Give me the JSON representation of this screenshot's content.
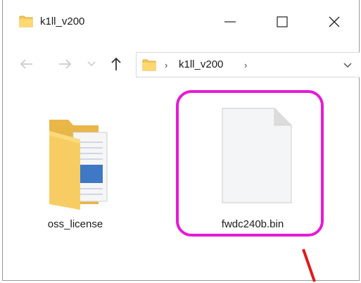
{
  "window": {
    "title": "k1ll_v200"
  },
  "address_bar": {
    "crumbs": [
      "k1ll_v200"
    ]
  },
  "files": [
    {
      "name": "oss_license",
      "type": "folder"
    },
    {
      "name": "fwdc240b.bin",
      "type": "file"
    }
  ],
  "icons": {
    "title": "folder-icon",
    "back": "arrow-left-icon",
    "forward": "arrow-right-icon",
    "recent": "chevron-down-icon",
    "up": "arrow-up-icon",
    "address_folder": "folder-icon",
    "address_dropdown": "chevron-down-icon",
    "minimize": "minimize-icon",
    "maximize": "maximize-icon",
    "close": "close-icon"
  },
  "colors": {
    "highlight": "#e61ad6",
    "arrow": "#e01b1b",
    "folder": "#f5c75a"
  }
}
